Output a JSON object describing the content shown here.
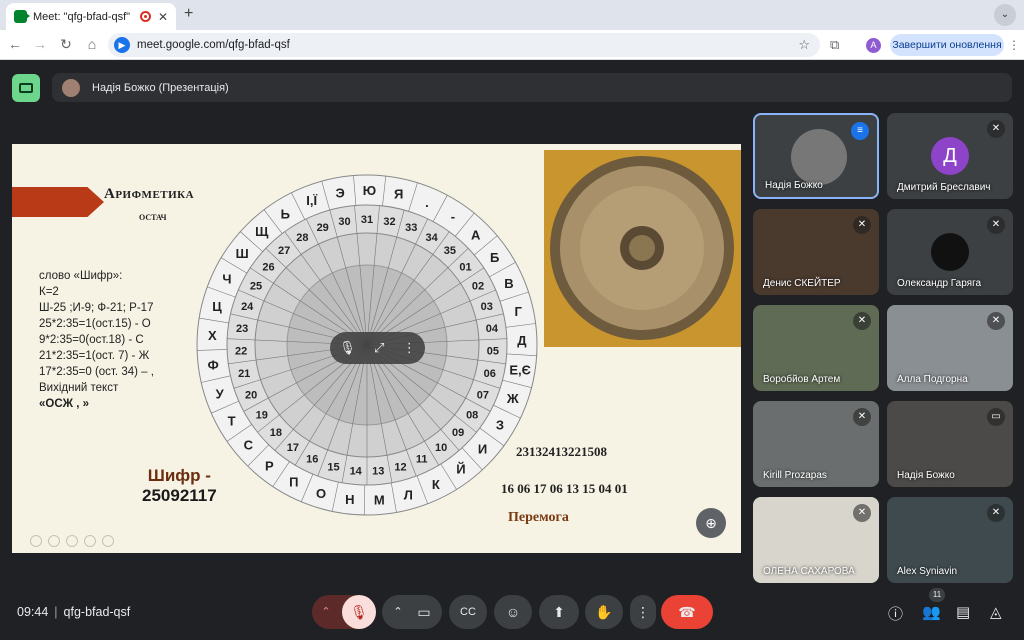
{
  "browser": {
    "tab_title": "Meet: \"qfg-bfad-qsf\"",
    "new_tab": "+",
    "url": "meet.google.com/qfg-bfad-qsf",
    "profile_initial": "A",
    "update_button": "Завершити оновлення"
  },
  "presentation_bar": {
    "title": "Надія Божко (Презентація)"
  },
  "slide": {
    "heading_line1": "Арифметика",
    "heading_line2": "остач",
    "left_lines": [
      "слово «Шифр»:",
      "К=2",
      " Ш-25 ;И-9;  Ф-21; Р-17",
      "25*2:35=1(ост.15) - О",
      "9*2:35=0(ост.18) - С",
      "21*2:35=1(ост. 7) - Ж",
      "17*2:35=0 (ост. 34) – ,",
      "Вихідний текст",
      "      «ОСЖ , »"
    ],
    "cipher_label": "Шифр -",
    "cipher_value": "25092117",
    "numbers1": "23132413221508",
    "numbers2": "16 06 17 06 13 15 04 01",
    "result_word": "Перемога",
    "outer_letters": [
      "Э",
      "Ю",
      "Я",
      ".",
      "-",
      "А",
      "Б",
      "В",
      "Г",
      "Д",
      "Е,Є",
      "Ж",
      "З",
      "И",
      "Й",
      "К",
      "Л",
      "М",
      "Н",
      "О",
      "П",
      "Р",
      "С",
      "Т",
      "У",
      "Ф",
      "Х",
      "Ц",
      "Ч",
      "Ш",
      "Щ",
      "Ь",
      "І,Ї"
    ],
    "inner_numbers": [
      "31",
      "32",
      "33",
      "34",
      "35",
      "01",
      "02",
      "03",
      "04",
      "05",
      "06",
      "07",
      "08",
      "09",
      "10",
      "11",
      "12",
      "13",
      "14",
      "15",
      "16",
      "17",
      "18",
      "19",
      "20",
      "21",
      "22",
      "23",
      "24",
      "25",
      "26",
      "27",
      "28",
      "29",
      "30"
    ]
  },
  "participants": [
    {
      "name": "Надія Божко",
      "initial": "",
      "state": "speaking"
    },
    {
      "name": "Дмитрий Бреславич",
      "initial": "Д",
      "state": "muted"
    },
    {
      "name": "Денис СКЕЙТЕР",
      "initial": "",
      "state": "muted"
    },
    {
      "name": "Олександр Гаряга",
      "initial": "",
      "state": "muted"
    },
    {
      "name": "Воробйов Артем",
      "initial": "",
      "state": "muted"
    },
    {
      "name": "Алла Подгорна",
      "initial": "",
      "state": "muted"
    },
    {
      "name": "Kirill Prozapas",
      "initial": "",
      "state": "muted"
    },
    {
      "name": "Надія Божко",
      "initial": "",
      "state": "presenting"
    },
    {
      "name": "ОЛЕНА САХАРОВА",
      "initial": "",
      "state": "muted"
    },
    {
      "name": "Alex Syniavin",
      "initial": "",
      "state": "muted"
    }
  ],
  "meeting": {
    "time": "09:44",
    "separator": "|",
    "code": "qfg-bfad-qsf",
    "people_count": "11"
  },
  "colors": {
    "end_call": "#ea4335",
    "mic_off": "#f9dedc",
    "accent": "#1a73e8"
  }
}
